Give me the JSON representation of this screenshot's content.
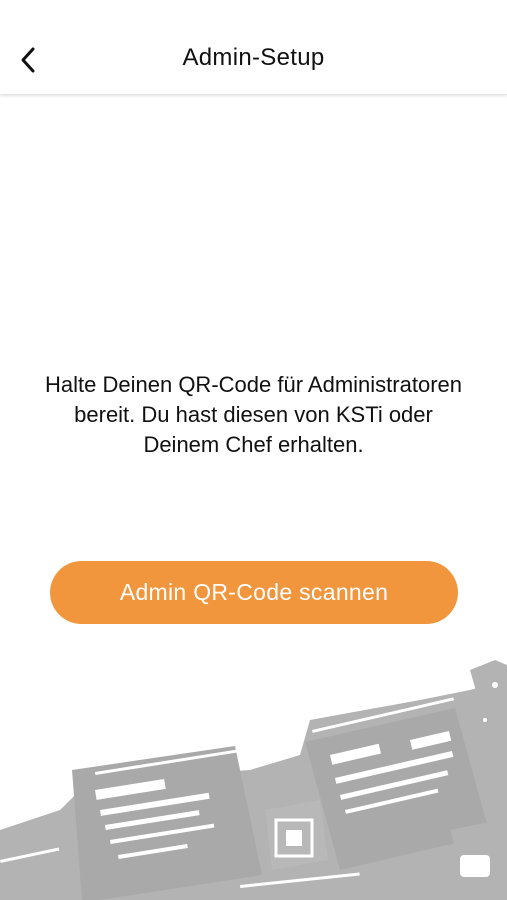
{
  "header": {
    "title": "Admin-Setup",
    "back_icon": "chevron-left-icon"
  },
  "main": {
    "info_text": "Halte Deinen QR-Code für Administratoren bereit. Du hast diesen von KSTi oder Deinem Chef erhalten.",
    "scan_button_label": "Admin QR-Code scannen"
  },
  "colors": {
    "accent": "#f2963d",
    "illustration": "#b3b3b3"
  }
}
